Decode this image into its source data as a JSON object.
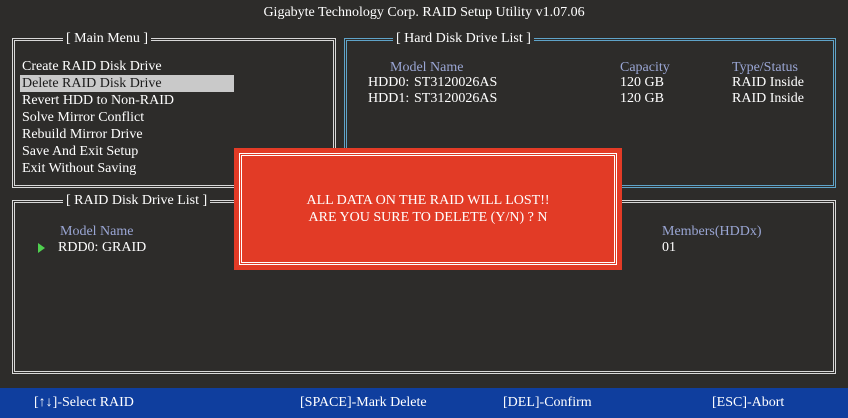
{
  "app": {
    "title": "Gigabyte Technology Corp.  RAID Setup Utility  v1.07.06"
  },
  "main_menu": {
    "title": "[ Main Menu ]",
    "items": [
      "Create RAID Disk Drive",
      "Delete RAID Disk Drive",
      "Revert HDD to Non-RAID",
      "Solve Mirror Conflict",
      "Rebuild Mirror Drive",
      "Save And Exit Setup",
      "Exit Without Saving"
    ],
    "selected_index": 1
  },
  "hdd_list": {
    "title": "[ Hard Disk Drive List ]",
    "headers": {
      "model": "Model Name",
      "capacity": "Capacity",
      "status": "Type/Status"
    },
    "rows": [
      {
        "id": "HDD0:",
        "model": "ST3120026AS",
        "capacity": "120 GB",
        "status": "RAID Inside"
      },
      {
        "id": "HDD1:",
        "model": "ST3120026AS",
        "capacity": "120 GB",
        "status": "RAID Inside"
      }
    ]
  },
  "raid_list": {
    "title": "[ RAID Disk Drive List ]",
    "headers": {
      "model": "Model Name",
      "members": "Members(HDDx)"
    },
    "rows": [
      {
        "name": "RDD0: GRAID",
        "members": "01"
      }
    ]
  },
  "dialog": {
    "line1": "ALL DATA ON THE RAID WILL LOST!!",
    "line2": "ARE YOU SURE TO DELETE (Y/N) ? N"
  },
  "footer": {
    "select": "[↑↓]-Select RAID",
    "mark": "[SPACE]-Mark Delete",
    "confirm": "[DEL]-Confirm",
    "abort": "[ESC]-Abort"
  },
  "colors": {
    "background": "#2d2c2a",
    "footer": "#0f3e9e",
    "dialog": "#e23b26",
    "header_text": "#9aa6d4",
    "hdd_frame": "#5fa3c8",
    "selection": "#c9c9c9",
    "marker": "#4fd04f"
  }
}
